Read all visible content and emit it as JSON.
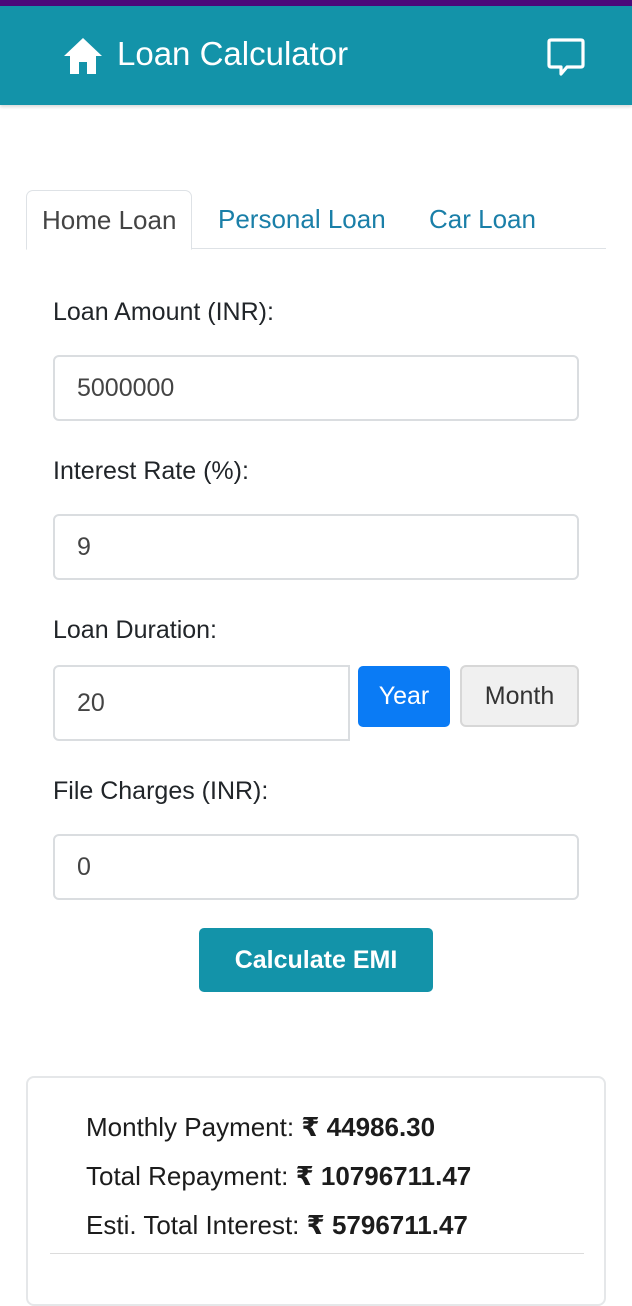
{
  "app": {
    "title": "Loan Calculator",
    "icons": {
      "left": "home-icon",
      "right": "chat-feedback-icon"
    }
  },
  "tabs": [
    {
      "label": "Home Loan",
      "active": true
    },
    {
      "label": "Personal Loan",
      "active": false
    },
    {
      "label": "Car Loan",
      "active": false
    }
  ],
  "form": {
    "loan_amount": {
      "label": "Loan Amount (INR):",
      "value": "5000000"
    },
    "interest_rate": {
      "label": "Interest Rate (%):",
      "value": "9"
    },
    "loan_duration": {
      "label": "Loan Duration:",
      "value": "20",
      "unit_options": [
        "Year",
        "Month"
      ],
      "selected_unit": "Year"
    },
    "file_charges": {
      "label": "File Charges (INR):",
      "value": "0"
    },
    "calculate_label": "Calculate EMI"
  },
  "results": {
    "currency_symbol": "₹",
    "monthly_payment": {
      "label": "Monthly Payment:",
      "value": "₹ 44986.30"
    },
    "total_repayment": {
      "label": "Total Repayment:",
      "value": "₹ 10796711.47"
    },
    "total_interest": {
      "label": "Esti. Total Interest:",
      "value": "₹ 5796711.47"
    }
  },
  "colors": {
    "primary": "#1393a9",
    "status_bar": "#4b0a7a",
    "selected_unit": "#0a7bf5",
    "tab_link": "#1a7fa8"
  }
}
